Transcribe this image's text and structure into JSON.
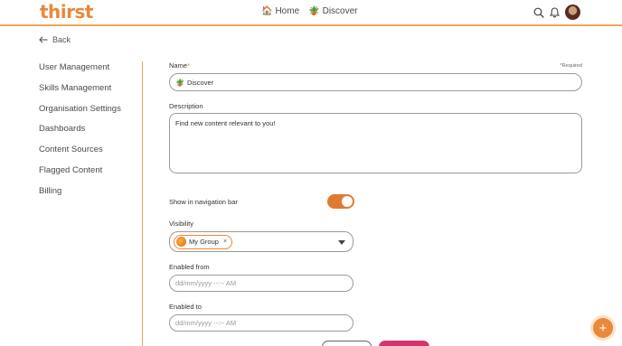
{
  "header": {
    "logo": "thirst",
    "nav": [
      {
        "label": "Home",
        "emoji": "🏠"
      },
      {
        "label": "Discover",
        "emoji": "🪴"
      }
    ],
    "icons": [
      "search-icon",
      "bell-icon",
      "avatar"
    ]
  },
  "back_label": "Back",
  "sidebar": {
    "items": [
      {
        "label": "User Management"
      },
      {
        "label": "Skills Management"
      },
      {
        "label": "Organisation Settings"
      },
      {
        "label": "Dashboards"
      },
      {
        "label": "Content Sources"
      },
      {
        "label": "Flagged Content"
      },
      {
        "label": "Billing"
      }
    ]
  },
  "form": {
    "name": {
      "label": "Name",
      "required_mark": "*",
      "required_hint": "*Required",
      "value": "Discover",
      "emoji": "🪴"
    },
    "description": {
      "label": "Description",
      "value": "Find new content relevant to you!"
    },
    "show_in_nav": {
      "label": "Show in navigation bar",
      "on": true
    },
    "visibility": {
      "label": "Visibility",
      "chip": "My Group",
      "chip_remove": "×"
    },
    "enabled_from": {
      "label": "Enabled from",
      "placeholder": "dd/mm/yyyy --:-- AM"
    },
    "enabled_to": {
      "label": "Enabled to",
      "placeholder": "dd/mm/yyyy --:-- AM"
    }
  },
  "fab": {
    "label": "+"
  },
  "colors": {
    "accent": "#e8893b",
    "toggle": "#e07a33",
    "pink": "#d6336c"
  }
}
